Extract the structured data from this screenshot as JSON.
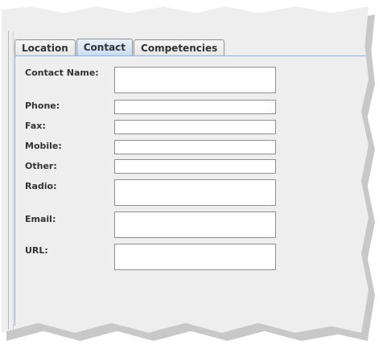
{
  "tabs": [
    {
      "label": "Location",
      "active": false
    },
    {
      "label": "Contact",
      "active": true
    },
    {
      "label": "Competencies",
      "active": false
    }
  ],
  "form": {
    "contact_name": {
      "label": "Contact Name:",
      "value": ""
    },
    "phone": {
      "label": "Phone:",
      "value": ""
    },
    "fax": {
      "label": "Fax:",
      "value": ""
    },
    "mobile": {
      "label": "Mobile:",
      "value": ""
    },
    "other": {
      "label": "Other:",
      "value": ""
    },
    "radio": {
      "label": "Radio:",
      "value": ""
    },
    "email": {
      "label": "Email:",
      "value": ""
    },
    "url": {
      "label": "URL:",
      "value": ""
    }
  },
  "colors": {
    "active_tab": "#c7dcf2",
    "panel_border": "#8fb0d8",
    "field_border": "#8e8f8f",
    "background": "#eeeeee"
  }
}
